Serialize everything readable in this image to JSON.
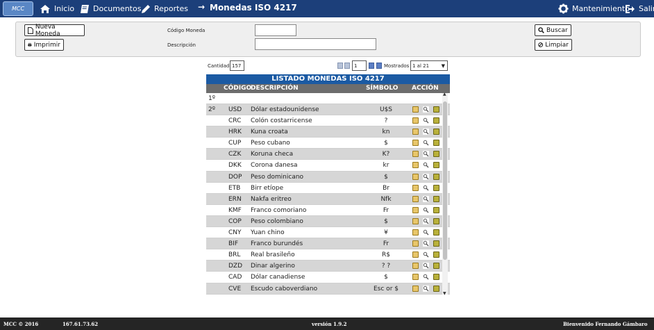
{
  "nav": {
    "logo_text": "MCC",
    "inicio": "Inicio",
    "documentos": "Documentos",
    "reportes": "Reportes",
    "arrow": "→",
    "page_title": "Monedas ISO 4217",
    "mantenimiento": "Mantenimiento",
    "salir": "Salir"
  },
  "filters": {
    "nueva_moneda": "Nueva Moneda",
    "imprimir": "Imprimir",
    "codigo_label": "Código Moneda",
    "codigo_value": "",
    "descripcion_label": "Descripción",
    "descripcion_value": "",
    "buscar": "Buscar",
    "limpiar": "Limpiar"
  },
  "pager": {
    "cantidad_label": "Cantidad",
    "cantidad_value": "157",
    "page_value": "1",
    "mostrados_label": "Mostrados",
    "mostrados_value": "1 al 21"
  },
  "grid": {
    "title": "LISTADO MONEDAS ISO 4217",
    "col_codigo": "CÓDIGO",
    "col_descripcion": "DESCRIPCIÓN",
    "col_simbolo": "SÍMBOLO",
    "col_accion": "ACCIÓN",
    "first_marker": "1º",
    "rows": [
      {
        "marker": "2º",
        "code": "USD",
        "desc": "Dólar estadounidense",
        "sym": "U$S"
      },
      {
        "marker": "",
        "code": "CRC",
        "desc": "Colón costarricense",
        "sym": "?"
      },
      {
        "marker": "",
        "code": "HRK",
        "desc": "Kuna croata",
        "sym": "kn"
      },
      {
        "marker": "",
        "code": "CUP",
        "desc": "Peso cubano",
        "sym": "$"
      },
      {
        "marker": "",
        "code": "CZK",
        "desc": "Koruna checa",
        "sym": "K?"
      },
      {
        "marker": "",
        "code": "DKK",
        "desc": "Corona danesa",
        "sym": "kr"
      },
      {
        "marker": "",
        "code": "DOP",
        "desc": "Peso dominicano",
        "sym": "$"
      },
      {
        "marker": "",
        "code": "ETB",
        "desc": "Birr etíope",
        "sym": "Br"
      },
      {
        "marker": "",
        "code": "ERN",
        "desc": "Nakfa eritreo",
        "sym": "Nfk"
      },
      {
        "marker": "",
        "code": "KMF",
        "desc": "Franco comoriano",
        "sym": "Fr"
      },
      {
        "marker": "",
        "code": "COP",
        "desc": "Peso colombiano",
        "sym": "$"
      },
      {
        "marker": "",
        "code": "CNY",
        "desc": "Yuan chino",
        "sym": "¥"
      },
      {
        "marker": "",
        "code": "BIF",
        "desc": "Franco burundés",
        "sym": "Fr"
      },
      {
        "marker": "",
        "code": "BRL",
        "desc": "Real brasileño",
        "sym": "R$"
      },
      {
        "marker": "",
        "code": "DZD",
        "desc": "Dinar algerino",
        "sym": "? ?"
      },
      {
        "marker": "",
        "code": "CAD",
        "desc": "Dólar canadiense",
        "sym": "$"
      },
      {
        "marker": "",
        "code": "CVE",
        "desc": "Escudo caboverdiano",
        "sym": "Esc or $"
      }
    ]
  },
  "footer": {
    "copyright": "MCC © 2016",
    "ip": "167.61.73.62",
    "version": "versión 1.9.2",
    "welcome": "Bienvenido Fernando Gámbaro"
  },
  "colors": {
    "topbar": "#1c3f7a",
    "grid_title": "#1b5aa3",
    "grid_head": "#6d6d6d",
    "row_alt": "#d6d6d6"
  }
}
